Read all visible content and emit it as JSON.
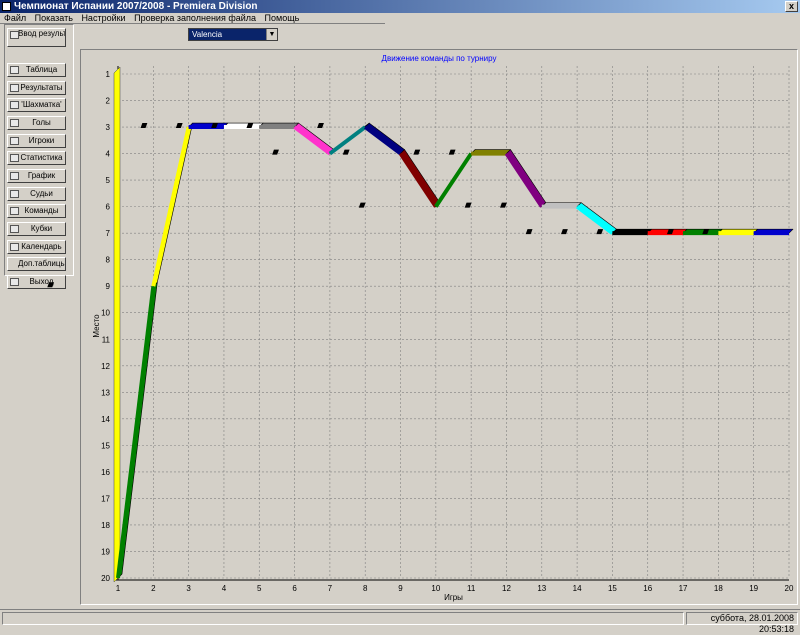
{
  "window": {
    "title": "Чемпионат Испании 2007/2008 - Premiera Division",
    "close_label": "x"
  },
  "menu": [
    "Файл",
    "Показать",
    "Настройки",
    "Проверка заполнения файла",
    "Помощь"
  ],
  "sidebar": [
    {
      "label": "Ввод результатов",
      "icon": "document-icon"
    },
    {
      "label": "Таблица",
      "icon": "list-icon"
    },
    {
      "label": "Результаты",
      "icon": "grid-icon"
    },
    {
      "label": "'Шахматка'",
      "icon": "chess-icon"
    },
    {
      "label": "Голы",
      "icon": "ball-icon"
    },
    {
      "label": "Игроки",
      "icon": "players-icon"
    },
    {
      "label": "Статистика",
      "icon": "stats-icon"
    },
    {
      "label": "График",
      "icon": "graph-icon"
    },
    {
      "label": "Судьи",
      "icon": "referee-icon"
    },
    {
      "label": "Команды",
      "icon": "teams-icon"
    },
    {
      "label": "Кубки",
      "icon": "cup-icon"
    },
    {
      "label": "Календарь",
      "icon": "calendar-icon"
    },
    {
      "label": "Доп.таблицы",
      "icon": ""
    },
    {
      "label": "Выход",
      "icon": "exit-icon"
    }
  ],
  "team_select": {
    "value": "Valencia"
  },
  "statusbar": {
    "left": "",
    "datetime": "суббота, 28.01.2008 20:53:18"
  },
  "chart_data": {
    "type": "line",
    "title": "Движение команды по турниру",
    "xlabel": "Игры",
    "ylabel": "Место",
    "x": [
      1,
      2,
      3,
      4,
      5,
      6,
      7,
      8,
      9,
      10,
      11,
      12,
      13,
      14,
      15,
      16,
      17,
      18,
      19,
      20
    ],
    "y_ticks": [
      1,
      2,
      3,
      4,
      5,
      6,
      7,
      8,
      9,
      10,
      11,
      12,
      13,
      14,
      15,
      16,
      17,
      18,
      19,
      20
    ],
    "xlim": [
      1,
      20
    ],
    "ylim": [
      20,
      1
    ],
    "y_inverted": true,
    "grid": true,
    "series": [
      {
        "values": [
          20,
          9,
          3,
          3,
          3,
          3,
          4,
          3,
          4,
          6,
          4,
          4,
          6,
          6,
          7,
          7,
          7,
          7,
          7,
          7
        ]
      }
    ],
    "segment_colors": [
      "#008000",
      "#ffff00",
      "#0000cc",
      "#ffffff",
      "#808080",
      "#ff33cc",
      "#008080",
      "#000080",
      "#800000",
      "#008000",
      "#808000",
      "#800080",
      "#c0c0c0",
      "#00ffff",
      "#000000",
      "#ff0000",
      "#008000",
      "#ffff00",
      "#0000cc"
    ],
    "left_bar_color": "#ffff00"
  }
}
